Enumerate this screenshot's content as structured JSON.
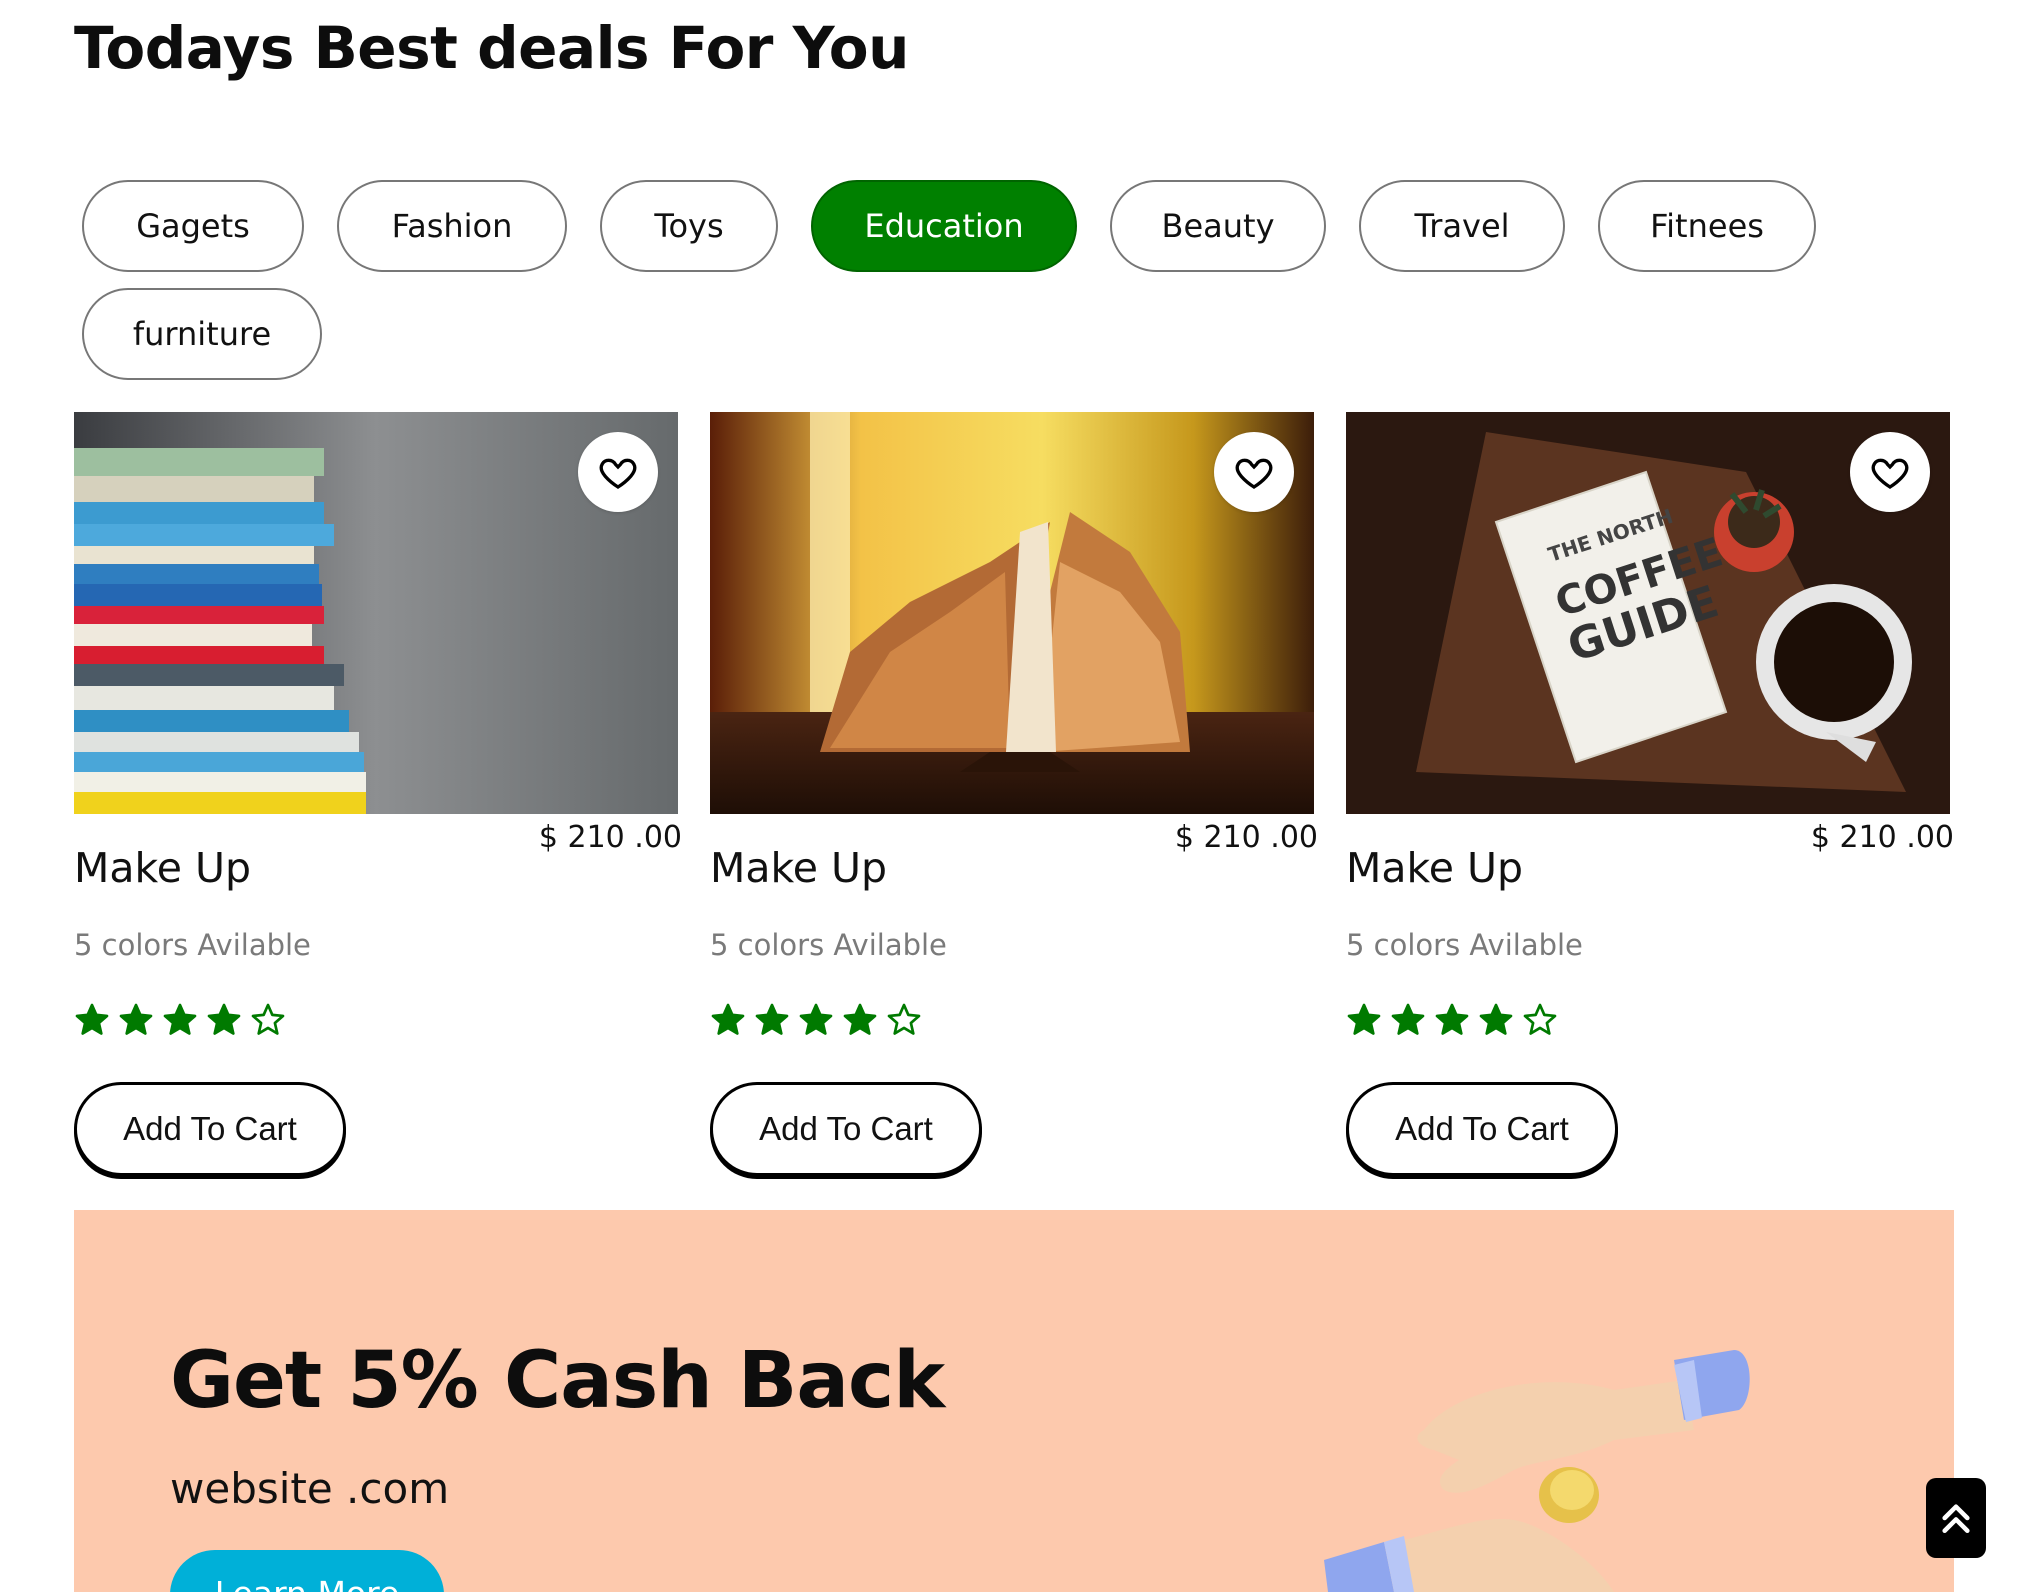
{
  "section": {
    "title": "Todays Best deals For You"
  },
  "categories": [
    {
      "label": "Gagets",
      "active": false
    },
    {
      "label": "Fashion",
      "active": false
    },
    {
      "label": "Toys",
      "active": false
    },
    {
      "label": "Education",
      "active": true
    },
    {
      "label": "Beauty",
      "active": false
    },
    {
      "label": "Travel",
      "active": false
    },
    {
      "label": "Fitnees",
      "active": false
    },
    {
      "label": "furniture",
      "active": false
    }
  ],
  "products": [
    {
      "name": "Make Up",
      "price": "$ 210 .00",
      "colors": "5 colors Avilable",
      "rating": 4,
      "rating_max": 5,
      "button": "Add To Cart",
      "image": "stacked-books-photo",
      "wishlist_icon": "heart-icon"
    },
    {
      "name": "Make Up",
      "price": "$ 210 .00",
      "colors": "5 colors Avilable",
      "rating": 4,
      "rating_max": 5,
      "button": "Add To Cart",
      "image": "open-book-photo",
      "wishlist_icon": "heart-icon"
    },
    {
      "name": "Make Up",
      "price": "$ 210 .00",
      "colors": "5 colors Avilable",
      "rating": 4,
      "rating_max": 5,
      "button": "Add To Cart",
      "image": "coffee-guide-book-photo",
      "wishlist_icon": "heart-icon"
    }
  ],
  "promo": {
    "title": "Get 5% Cash Back",
    "subtitle": "website .com",
    "button": "Learn More",
    "background": "#fdc9ad",
    "button_color": "#00b0d8",
    "image_book_text": [
      "THE NORTH",
      "COFFEE",
      "GUIDE"
    ]
  },
  "colors": {
    "accent": "#008000",
    "star": "#007a00"
  },
  "scroll_top_icon": "double-chevron-up-icon"
}
